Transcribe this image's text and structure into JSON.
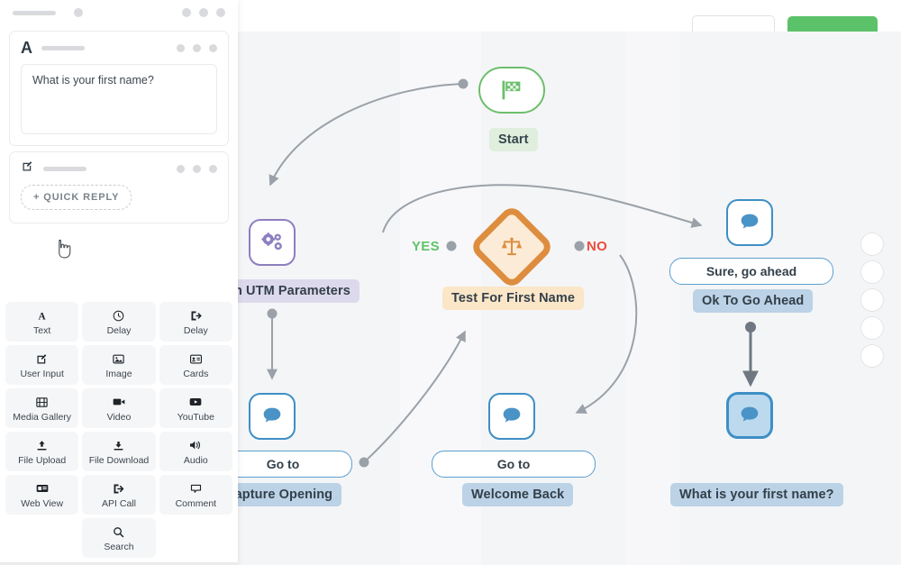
{
  "topbar": {
    "secondary_button": {
      "label": "",
      "icon": "redacted-bar"
    },
    "primary_button": {
      "label": "",
      "icon": "redacted-bar",
      "color": "#5cc269"
    }
  },
  "canvas": {
    "background": "#f4f5f7",
    "zoom_controls": [
      "zoom-in",
      "zoom-out",
      "fit-screen",
      "reset",
      "more"
    ],
    "nodes": [
      {
        "id": "start",
        "type": "start",
        "icon": "checkered-flag-icon",
        "label": "Start",
        "color": "#6cbf6c"
      },
      {
        "id": "utm",
        "type": "action",
        "icon": "gears-icon",
        "label": "gn UTM Parameters",
        "color": "#8d7fc0"
      },
      {
        "id": "condition",
        "type": "condition",
        "icon": "scales-icon",
        "label": "Test For First Name",
        "color": "#de8d3f",
        "yes_label": "YES",
        "no_label": "NO"
      },
      {
        "id": "sure",
        "type": "message",
        "icon": "chat-bubble-icon",
        "pill": "Sure, go ahead",
        "label": "Ok To Go Ahead",
        "color": "#3e8fc4"
      },
      {
        "id": "capture",
        "type": "message",
        "icon": "chat-bubble-icon",
        "pill": "Go to",
        "label": "Capture Opening",
        "color": "#3e8fc4"
      },
      {
        "id": "welcome",
        "type": "message",
        "icon": "chat-bubble-icon",
        "pill": "Go to",
        "label": "Welcome Back",
        "color": "#3e8fc4"
      },
      {
        "id": "firstname",
        "type": "message",
        "icon": "chat-bubble-icon",
        "pill": "",
        "label": "What is your first name?",
        "color": "#3e8fc4",
        "selected": true
      }
    ]
  },
  "left_panel": {
    "header": {
      "title_bar": "redacted",
      "dot": "status-dot",
      "menu": "three-dots-menu"
    },
    "cards": [
      {
        "id": "text-card",
        "icon": "A",
        "title_bar": "redacted",
        "menu": "three-dots-menu",
        "body_text": "What is your first name?"
      },
      {
        "id": "user-input-card",
        "icon": "user-input-icon",
        "title_bar": "redacted",
        "menu": "three-dots-menu",
        "add_button": "+ QUICK REPLY"
      }
    ],
    "cursor": "pointing-hand-cursor"
  },
  "palette": {
    "items": [
      {
        "label": "Text",
        "icon": "text-icon"
      },
      {
        "label": "Delay",
        "icon": "clock-icon"
      },
      {
        "label": "Delay",
        "icon": "exit-icon"
      },
      {
        "label": "User Input",
        "icon": "pencil-square-icon"
      },
      {
        "label": "Image",
        "icon": "image-icon"
      },
      {
        "label": "Cards",
        "icon": "id-card-icon"
      },
      {
        "label": "Media Gallery",
        "icon": "film-icon"
      },
      {
        "label": "Video",
        "icon": "video-camera-icon"
      },
      {
        "label": "YouTube",
        "icon": "youtube-icon"
      },
      {
        "label": "File Upload",
        "icon": "upload-icon"
      },
      {
        "label": "File Download",
        "icon": "download-icon"
      },
      {
        "label": "Audio",
        "icon": "speaker-icon"
      },
      {
        "label": "Web View",
        "icon": "web-view-icon"
      },
      {
        "label": "API Call",
        "icon": "api-call-icon"
      },
      {
        "label": "Comment",
        "icon": "comment-icon"
      },
      {
        "label": "Search",
        "icon": "search-icon"
      }
    ]
  }
}
